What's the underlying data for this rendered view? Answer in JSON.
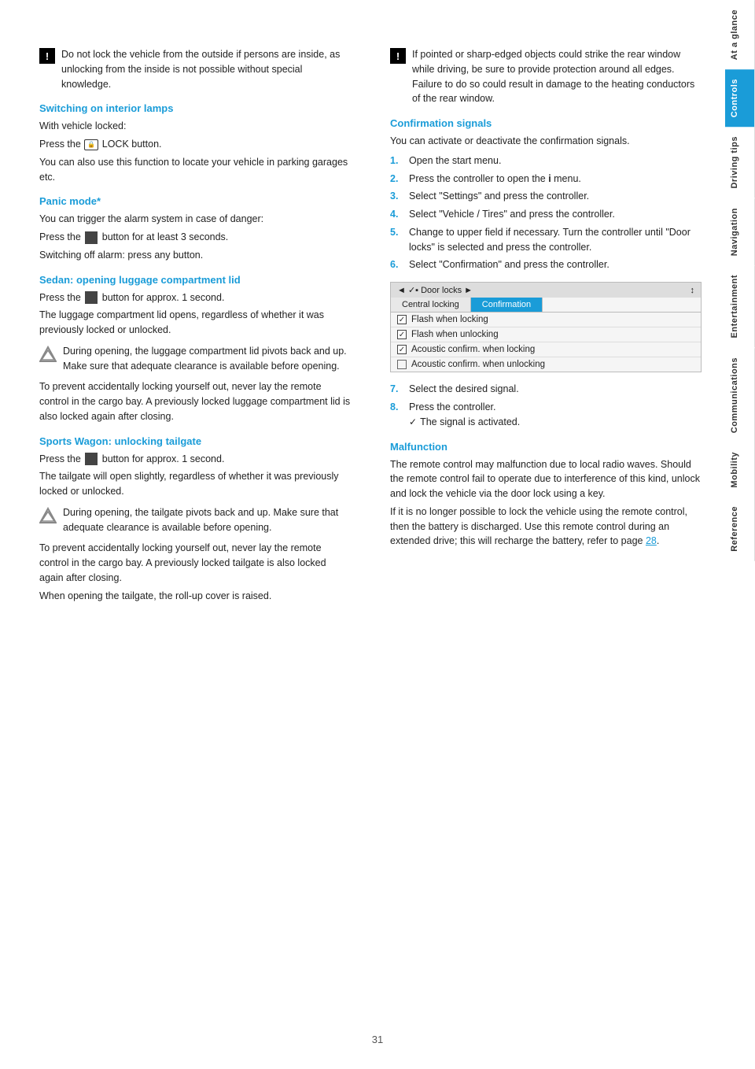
{
  "page": {
    "number": "31"
  },
  "sidebar": {
    "tabs": [
      {
        "label": "At a glance",
        "active": false
      },
      {
        "label": "Controls",
        "active": true
      },
      {
        "label": "Driving tips",
        "active": false
      },
      {
        "label": "Navigation",
        "active": false
      },
      {
        "label": "Entertainment",
        "active": false
      },
      {
        "label": "Communications",
        "active": false
      },
      {
        "label": "Mobility",
        "active": false
      },
      {
        "label": "Reference",
        "active": false
      }
    ]
  },
  "left_col": {
    "warning1": {
      "text": "Do not lock the vehicle from the outside if persons are inside, as unlocking from the inside is not possible without special knowledge."
    },
    "switching_interior_lamps": {
      "heading": "Switching on interior lamps",
      "para1": "With vehicle locked:",
      "para2": "Press the  LOCK button.",
      "para3": "You can also use this function to locate your vehicle in parking garages etc."
    },
    "panic_mode": {
      "heading": "Panic mode*",
      "para1": "You can trigger the alarm system in case of danger:",
      "para2": "Press the  button for at least 3 seconds.",
      "para3": "Switching off alarm: press any button."
    },
    "sedan_heading": "Sedan: opening luggage compartment lid",
    "sedan_para1": "Press the  button for approx. 1 second.",
    "sedan_para2": "The luggage compartment lid opens, regardless of whether it was previously locked or unlocked.",
    "sedan_note": "During opening, the luggage compartment lid pivots back and up. Make sure that adequate clearance is available before opening.",
    "sedan_para3": "To prevent accidentally locking yourself out, never lay the remote control in the cargo bay. A previously locked luggage compartment lid is also locked again after closing.",
    "sports_wagon": {
      "heading": "Sports Wagon: unlocking tailgate",
      "para1": "Press the  button for approx. 1 second.",
      "para2": "The tailgate will open slightly, regardless of whether it was previously locked or unlocked.",
      "note": "During opening, the tailgate pivots back and up. Make sure that adequate clearance is available before opening.",
      "para3": "To prevent accidentally locking yourself out, never lay the remote control in the cargo bay. A previously locked tailgate is also locked again after closing.",
      "para4": "When opening the tailgate, the roll-up cover is raised."
    }
  },
  "right_col": {
    "warning2": {
      "text": "If pointed or sharp-edged objects could strike the rear window while driving, be sure to provide protection around all edges. Failure to do so could result in damage to the heating conductors of the rear window."
    },
    "confirmation_signals": {
      "heading": "Confirmation signals",
      "intro": "You can activate or deactivate the confirmation signals.",
      "steps": [
        {
          "num": "1.",
          "text": "Open the start menu."
        },
        {
          "num": "2.",
          "text": "Press the controller to open the  menu."
        },
        {
          "num": "3.",
          "text": "Select \"Settings\" and press the controller."
        },
        {
          "num": "4.",
          "text": "Select \"Vehicle / Tires\" and press the controller."
        },
        {
          "num": "5.",
          "text": "Change to upper field if necessary. Turn the controller until \"Door locks\" is selected and press the controller."
        },
        {
          "num": "6.",
          "text": "Select \"Confirmation\" and press the controller."
        }
      ]
    },
    "widget": {
      "header_left": "◄ ✓▪ Door locks ►",
      "header_right": "↕",
      "tab1": "Central locking",
      "tab2": "Confirmation",
      "row1": "Flash when locking",
      "row2": "Flash when unlocking",
      "row3": "Acoustic confirm. when locking",
      "row4": "Acoustic confirm. when unlocking"
    },
    "steps_cont": [
      {
        "num": "7.",
        "text": "Select the desired signal."
      },
      {
        "num": "8.",
        "text": "Press the controller."
      }
    ],
    "signal_activated": "The signal is activated.",
    "malfunction": {
      "heading": "Malfunction",
      "para1": "The remote control may malfunction due to local radio waves. Should the remote control fail to operate due to interference of this kind, unlock and lock the vehicle via the door lock using a key.",
      "para2": "If it is no longer possible to lock the vehicle using the remote control, then the battery is discharged. Use this remote control during an extended drive; this will recharge the battery, refer to page ",
      "page_link": "28",
      "para2_end": "."
    }
  }
}
